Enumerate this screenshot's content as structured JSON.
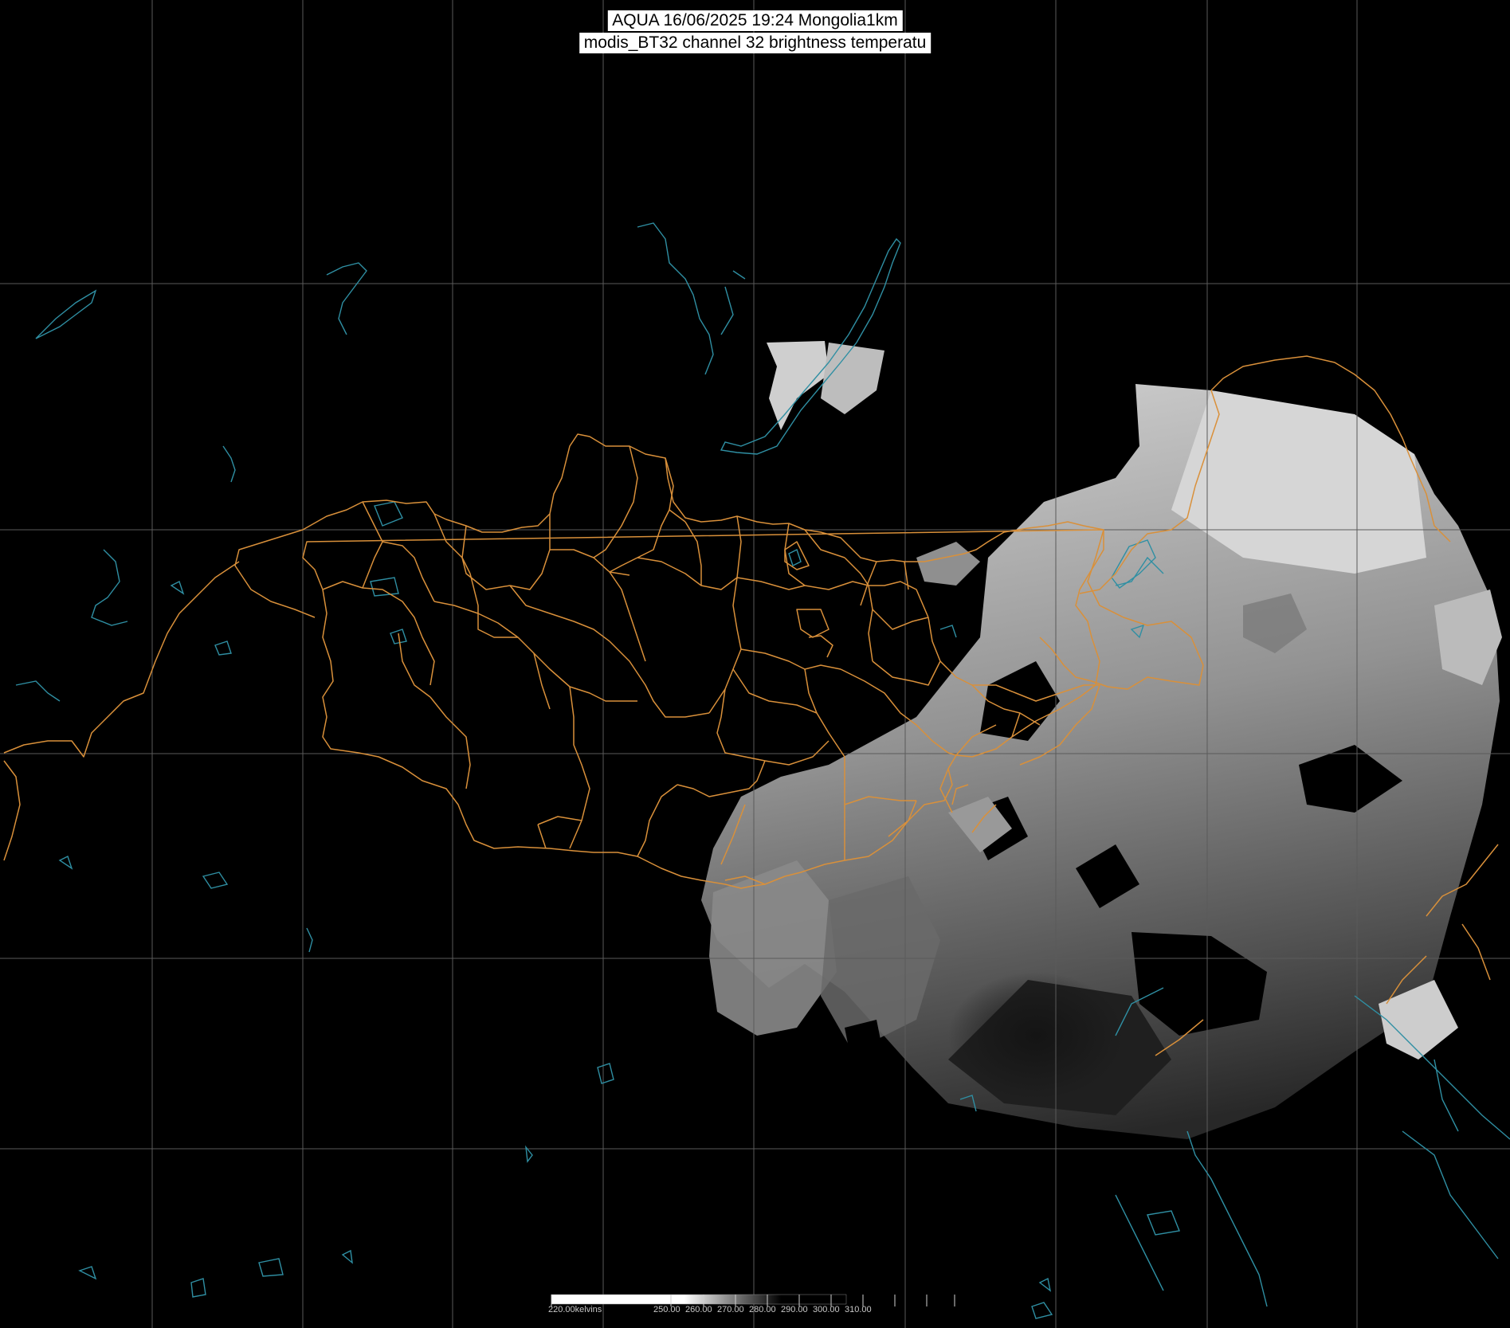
{
  "header": {
    "line1": "AQUA 16/06/2025 19:24 Mongolia1km",
    "line2": "modis_BT32 channel 32 brightness temperatu"
  },
  "colorbar": {
    "unit_label": "220.00kelvins",
    "tick_labels": [
      "250.00",
      "260.00",
      "270.00",
      "280.00",
      "290.00",
      "300.00",
      "310.00"
    ],
    "range": [
      220,
      320
    ]
  },
  "colors": {
    "background": "#000000",
    "grid": "#5a5a5a",
    "admin_borders": "#d9903a",
    "coast_lakes": "#2f8fa3",
    "imagery_light": "#e6e6e6",
    "imagery_dark": "#1a1a1a"
  },
  "map": {
    "country": "Mongolia",
    "projection_grid": true
  }
}
